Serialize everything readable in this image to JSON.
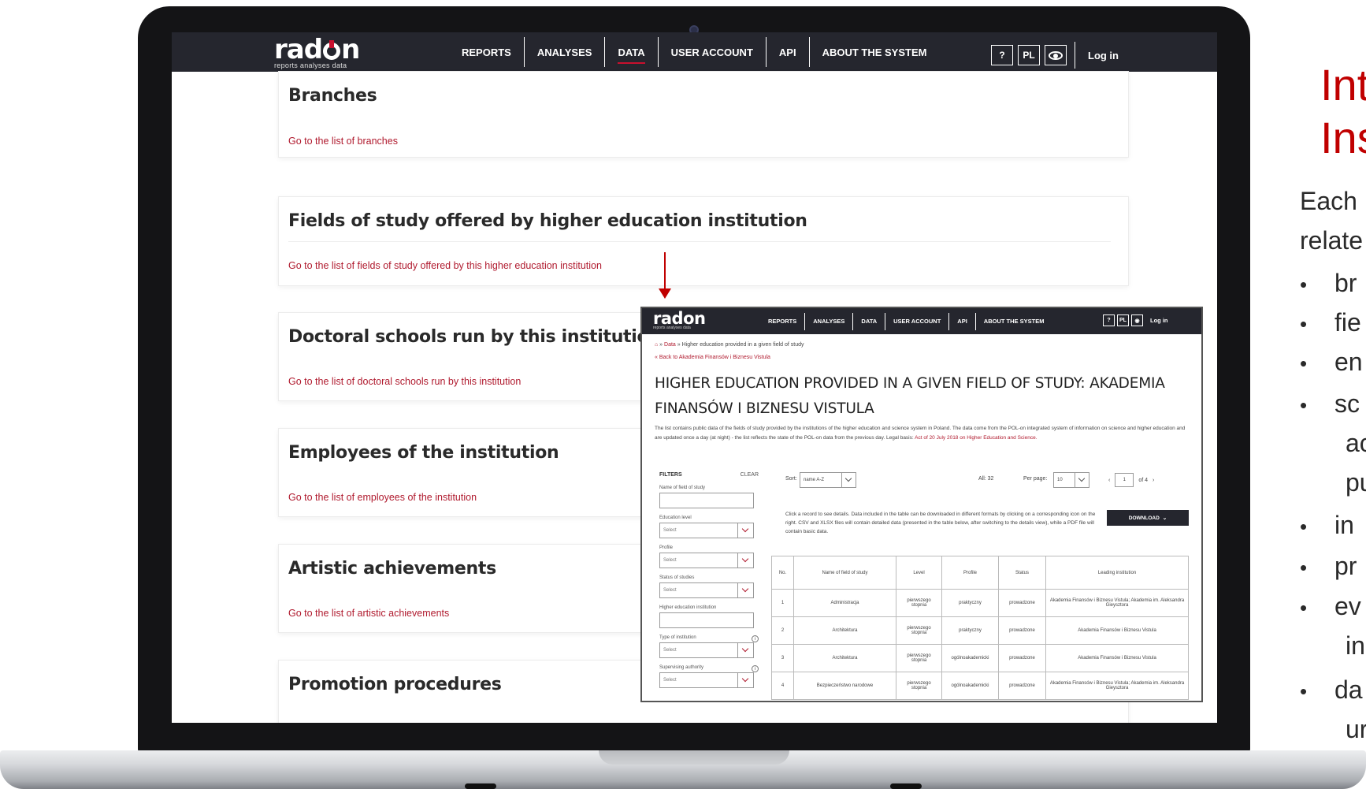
{
  "site": {
    "logo": "rad",
    "logo_end": "n",
    "logo_tagline": "reports   analyses   data",
    "nav": [
      "REPORTS",
      "ANALYSES",
      "DATA",
      "USER ACCOUNT",
      "API",
      "ABOUT THE SYSTEM"
    ],
    "active_nav": "DATA",
    "help": "?",
    "lang": "PL",
    "login": "Log in"
  },
  "sections": [
    {
      "title": "Branches",
      "link": "Go to the list of branches"
    },
    {
      "title": "Fields of study offered by higher education institution",
      "link": "Go to the list of fields of study offered by this higher education institution"
    },
    {
      "title": "Doctoral schools run by this institution",
      "link": "Go to the list of doctoral schools run by this institution"
    },
    {
      "title": "Employees of the institution",
      "link": "Go to the list of employees of the institution"
    },
    {
      "title": "Artistic achievements",
      "link": "Go to the list of artistic achievements"
    },
    {
      "title": "Promotion procedures",
      "link": ""
    }
  ],
  "inset": {
    "breadcrumb_home": "⌂",
    "breadcrumb_data": "Data",
    "breadcrumb_current": "Higher education provided in a given field of study",
    "back_link": "«  Back to Akademia Finansów i Biznesu Vistula",
    "title": "HIGHER EDUCATION PROVIDED IN A GIVEN FIELD OF STUDY: AKADEMIA FINANSÓW I BIZNESU VISTULA",
    "description": "The list contains public data of the fields of study provided by the institutions of the higher education and science system in Poland. The data come from the POL-on integrated system of information on science and higher education and are updated once a day (at night) - the list reflects the state of the POL-on data from the previous day. Legal basis: ",
    "description_link1": "Act of 20 July 2018 on Higher Education and Science.",
    "filters_label": "FILTERS",
    "clear_label": "CLEAR",
    "filters": [
      {
        "label": "Name of field of study",
        "type": "input",
        "value": ""
      },
      {
        "label": "Education level",
        "type": "select",
        "value": "Select"
      },
      {
        "label": "Profile",
        "type": "select",
        "value": "Select"
      },
      {
        "label": "Status of studies",
        "type": "select",
        "value": "Select"
      },
      {
        "label": "Higher education institution",
        "type": "input",
        "value": ""
      },
      {
        "label": "Type of institution",
        "type": "select",
        "value": "Select",
        "info": "i"
      },
      {
        "label": "Supervising authority",
        "type": "select",
        "value": "Select",
        "info": "i"
      }
    ],
    "sort_label": "Sort:",
    "sort_value": "name A-Z",
    "all_count": "All: 32",
    "per_page_label": "Per page:",
    "per_page_value": "10",
    "page_prev": "‹",
    "page_value": "1",
    "page_of": "of 4",
    "page_next": "›",
    "download_hint": "Click a record to see details. Data included in the table can be downloaded in different formats by clicking on a corresponding icon on the right. CSV and XLSX files will contain detailed data (presented in the table below, after switching to the details view), while a PDF file will contain basic data.",
    "download_label": "DOWNLOAD",
    "table": {
      "headers": [
        "No.",
        "Name of field of study",
        "Level",
        "Profile",
        "Status",
        "Leading institution"
      ],
      "rows": [
        [
          "1",
          "Administracja",
          "pierwszego stopnia",
          "praktyczny",
          "prowadzone",
          "Akademia Finansów i Biznesu Vistula; Akademia im. Aleksandra Gieysztora"
        ],
        [
          "2",
          "Architektura",
          "pierwszego stopnia",
          "praktyczny",
          "prowadzone",
          "Akademia Finansów i Biznesu Vistula"
        ],
        [
          "3",
          "Architektura",
          "pierwszego stopnia",
          "ogólnoakademicki",
          "prowadzone",
          "Akademia Finansów i Biznesu Vistula"
        ],
        [
          "4",
          "Bezpieczeństwo narodowe",
          "pierwszego stopnia",
          "ogólnoakademicki",
          "prowadzone",
          "Akademia Finansów i Biznesu Vistula; Akademia im. Aleksandra Gieysztora"
        ]
      ]
    }
  },
  "slide": {
    "title_line1": "Inte",
    "title_line2": "Ins",
    "intro_line1": "Each",
    "intro_line2": "relate",
    "bullets": [
      {
        "dot": "•",
        "text": "br",
        "cont": []
      },
      {
        "dot": "•",
        "text": "fie",
        "cont": []
      },
      {
        "dot": "•",
        "text": "en",
        "cont": []
      },
      {
        "dot": "•",
        "text": "sc",
        "cont": [
          "ac",
          "pu"
        ]
      },
      {
        "dot": "•",
        "text": "in",
        "cont": []
      },
      {
        "dot": "•",
        "text": "pr",
        "cont": []
      },
      {
        "dot": "•",
        "text": "ev",
        "cont": [
          "in"
        ]
      },
      {
        "dot": "•",
        "text": "da",
        "cont": [
          "ur"
        ]
      }
    ]
  }
}
